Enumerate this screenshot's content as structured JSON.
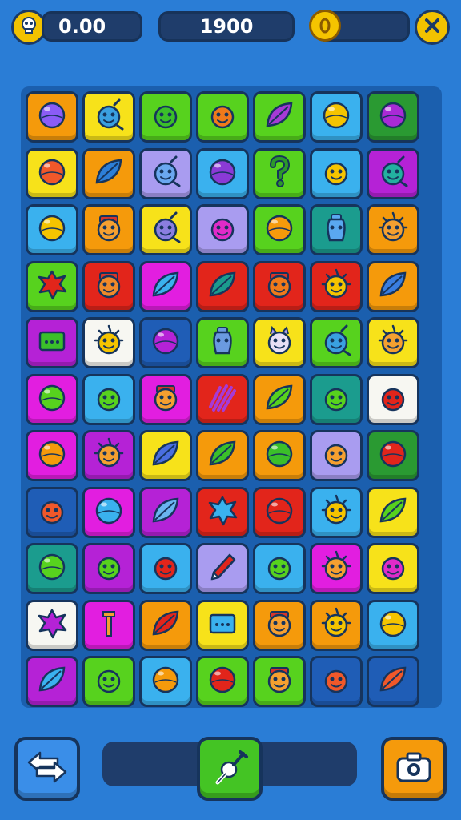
{
  "hud": {
    "skull_button_icon": "skull-icon",
    "score": "0.00",
    "target": "1900",
    "coin_icon": "coin-icon",
    "progress": 0.05,
    "close_button_icon": "close-icon"
  },
  "palette": {
    "orange": "#f59a0b",
    "yellow": "#f7e21a",
    "green": "#57d21e",
    "teal": "#1b9c8e",
    "purple": "#b522d6",
    "magenta": "#e21ee0",
    "blue": "#3ab1ee",
    "lavender": "#a99cf0",
    "red": "#e2251b",
    "white": "#f7f7f2",
    "darkblue": "#1f5db6",
    "darkgreen": "#2a9a32"
  },
  "board": {
    "rows": [
      [
        {
          "bg": "orange",
          "icon": "rainbow-ball",
          "c": "#8b5cf6"
        },
        {
          "bg": "yellow",
          "icon": "blue-face",
          "c": "#3aa0e0"
        },
        {
          "bg": "green",
          "icon": "green-face",
          "c": "#3bbf2a"
        },
        {
          "bg": "green",
          "icon": "orange-face",
          "c": "#f07a1b"
        },
        {
          "bg": "green",
          "icon": "purple-leaf",
          "c": "#a63ad6"
        },
        {
          "bg": "blue",
          "icon": "yellow-ball",
          "c": "#f5c400"
        },
        {
          "bg": "darkgreen",
          "icon": "purple-ball",
          "c": "#a92ad6"
        }
      ],
      [
        {
          "bg": "yellow",
          "icon": "rainbow-ball",
          "c": "#f0582a"
        },
        {
          "bg": "orange",
          "icon": "blue-leaf",
          "c": "#2d7fd8"
        },
        {
          "bg": "lavender",
          "icon": "blue-face",
          "c": "#6aa8f0"
        },
        {
          "bg": "blue",
          "icon": "purple-ball",
          "c": "#8b3ad6"
        },
        {
          "bg": "green",
          "icon": "question",
          "c": "#2c9a2a"
        },
        {
          "bg": "blue",
          "icon": "yellow-face",
          "c": "#f5c400"
        },
        {
          "bg": "purple",
          "icon": "teal-face",
          "c": "#23b0a0"
        }
      ],
      [
        {
          "bg": "blue",
          "icon": "yellow-ball",
          "c": "#f5c400"
        },
        {
          "bg": "orange",
          "icon": "hat-face",
          "c": "#f5a030"
        },
        {
          "bg": "yellow",
          "icon": "purple-face",
          "c": "#8a7ee0"
        },
        {
          "bg": "lavender",
          "icon": "magenta-face",
          "c": "#e02bc8"
        },
        {
          "bg": "green",
          "icon": "orange-ball",
          "c": "#f59a0b"
        },
        {
          "bg": "teal",
          "icon": "blue-jar",
          "c": "#5aa8f0"
        },
        {
          "bg": "orange",
          "icon": "sun-face",
          "c": "#f5a030"
        }
      ],
      [
        {
          "bg": "green",
          "icon": "red-splat",
          "c": "#e2251b"
        },
        {
          "bg": "red",
          "icon": "hat-face",
          "c": "#f08a2a"
        },
        {
          "bg": "magenta",
          "icon": "blue-leaf",
          "c": "#3ab1ee"
        },
        {
          "bg": "red",
          "icon": "teal-leaf",
          "c": "#1b9c8e"
        },
        {
          "bg": "red",
          "icon": "hat-face",
          "c": "#f07a1b"
        },
        {
          "bg": "red",
          "icon": "sun-face",
          "c": "#f5c400"
        },
        {
          "bg": "orange",
          "icon": "blue-leaf",
          "c": "#3a7ee0"
        }
      ],
      [
        {
          "bg": "purple",
          "icon": "green-box",
          "c": "#3bbf2a"
        },
        {
          "bg": "white",
          "icon": "sun-face",
          "c": "#f5c400"
        },
        {
          "bg": "darkblue",
          "icon": "purple-ball",
          "c": "#b522d6"
        },
        {
          "bg": "green",
          "icon": "blue-jar",
          "c": "#6a9ae0"
        },
        {
          "bg": "yellow",
          "icon": "cat-face",
          "c": "#e8e0f5"
        },
        {
          "bg": "green",
          "icon": "blue-face",
          "c": "#3aa0e0"
        },
        {
          "bg": "yellow",
          "icon": "sun-face",
          "c": "#f5a030"
        }
      ],
      [
        {
          "bg": "magenta",
          "icon": "green-ball",
          "c": "#57d21e"
        },
        {
          "bg": "blue",
          "icon": "green-face",
          "c": "#57d21e"
        },
        {
          "bg": "magenta",
          "icon": "hat-face",
          "c": "#f5a030"
        },
        {
          "bg": "red",
          "icon": "purple-scribble",
          "c": "#a63ad6"
        },
        {
          "bg": "orange",
          "icon": "green-leaf",
          "c": "#57d21e"
        },
        {
          "bg": "teal",
          "icon": "green-face",
          "c": "#57d21e"
        },
        {
          "bg": "white",
          "icon": "red-face",
          "c": "#e2251b"
        }
      ],
      [
        {
          "bg": "magenta",
          "icon": "orange-ball",
          "c": "#f59a0b"
        },
        {
          "bg": "purple",
          "icon": "sun-face",
          "c": "#f5a030"
        },
        {
          "bg": "yellow",
          "icon": "blue-leaf",
          "c": "#4a6ee0"
        },
        {
          "bg": "orange",
          "icon": "green-leaf",
          "c": "#3bbf2a"
        },
        {
          "bg": "orange",
          "icon": "green-ball",
          "c": "#3bbf2a"
        },
        {
          "bg": "lavender",
          "icon": "orange-face",
          "c": "#f5a030"
        },
        {
          "bg": "darkgreen",
          "icon": "red-ball",
          "c": "#e2251b"
        }
      ],
      [
        {
          "bg": "darkblue",
          "icon": "orange-face",
          "c": "#f0582a"
        },
        {
          "bg": "magenta",
          "icon": "rainbow-ball",
          "c": "#3ab1ee"
        },
        {
          "bg": "purple",
          "icon": "blue-leaf",
          "c": "#6ab4f0"
        },
        {
          "bg": "red",
          "icon": "blue-splat",
          "c": "#3ab1ee"
        },
        {
          "bg": "red",
          "icon": "rainbow-ball",
          "c": "#e2251b"
        },
        {
          "bg": "blue",
          "icon": "sun-face",
          "c": "#f5c400"
        },
        {
          "bg": "yellow",
          "icon": "green-leaf",
          "c": "#57d21e"
        }
      ],
      [
        {
          "bg": "teal",
          "icon": "green-ball",
          "c": "#57d21e"
        },
        {
          "bg": "purple",
          "icon": "green-face",
          "c": "#57d21e"
        },
        {
          "bg": "blue",
          "icon": "red-face",
          "c": "#e2251b"
        },
        {
          "bg": "lavender",
          "icon": "pencil",
          "c": "#e2251b"
        },
        {
          "bg": "blue",
          "icon": "green-face",
          "c": "#57d21e"
        },
        {
          "bg": "magenta",
          "icon": "sun-face",
          "c": "#f5a030"
        },
        {
          "bg": "yellow",
          "icon": "magenta-face",
          "c": "#e02bc8"
        }
      ],
      [
        {
          "bg": "white",
          "icon": "purple-splat",
          "c": "#b522d6"
        },
        {
          "bg": "magenta",
          "icon": "orange-tool",
          "c": "#f5a030"
        },
        {
          "bg": "orange",
          "icon": "red-leaf",
          "c": "#e2251b"
        },
        {
          "bg": "yellow",
          "icon": "blue-box",
          "c": "#3ab1ee"
        },
        {
          "bg": "orange",
          "icon": "hat-face",
          "c": "#f5a030"
        },
        {
          "bg": "orange",
          "icon": "sun-face",
          "c": "#f5c400"
        },
        {
          "bg": "blue",
          "icon": "yellow-ball",
          "c": "#f5c400"
        }
      ],
      [
        {
          "bg": "purple",
          "icon": "blue-leaf",
          "c": "#3ab1ee"
        },
        {
          "bg": "green",
          "icon": "green-face",
          "c": "#57d21e"
        },
        {
          "bg": "blue",
          "icon": "orange-ball",
          "c": "#f59a0b"
        },
        {
          "bg": "green",
          "icon": "red-ball",
          "c": "#e2251b"
        },
        {
          "bg": "green",
          "icon": "hat-face",
          "c": "#f5a030"
        },
        {
          "bg": "darkblue",
          "icon": "orange-face",
          "c": "#f0582a"
        },
        {
          "bg": "darkblue",
          "icon": "orange-leaf",
          "c": "#f0582a"
        }
      ]
    ]
  },
  "bottom": {
    "left_button_icon": "swap-arrows-icon",
    "slider_handle_icon": "plunger-icon",
    "right_button_icon": "camera-icon"
  }
}
